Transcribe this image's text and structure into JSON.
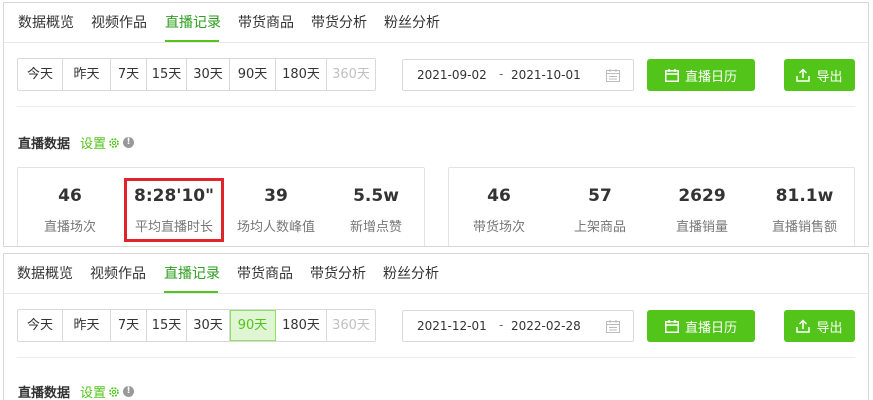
{
  "tabs": [
    "数据概览",
    "视频作品",
    "直播记录",
    "带货商品",
    "带货分析",
    "粉丝分析"
  ],
  "active_tab": "直播记录",
  "range_buttons": [
    "今天",
    "昨天",
    "7天",
    "15天",
    "30天",
    "90天",
    "180天",
    "360天"
  ],
  "panel_top": {
    "date_start": "2021-09-02",
    "date_end": "2021-10-01",
    "selected_range": ""
  },
  "panel_bottom": {
    "date_start": "2021-12-01",
    "date_end": "2022-02-28",
    "selected_range": "90天"
  },
  "date_separator": "-",
  "calendar_button_label": "直播日历",
  "export_button_label": "导出",
  "section_title": "直播数据",
  "settings_label": "设置",
  "stats_left": [
    {
      "value": "46",
      "label": "直播场次"
    },
    {
      "value": "8:28'10\"",
      "label": "平均直播时长"
    },
    {
      "value": "39",
      "label": "场均人数峰值"
    },
    {
      "value": "5.5w",
      "label": "新增点赞"
    }
  ],
  "stats_right": [
    {
      "value": "46",
      "label": "带货场次"
    },
    {
      "value": "57",
      "label": "上架商品"
    },
    {
      "value": "2629",
      "label": "直播销量"
    },
    {
      "value": "81.1w",
      "label": "直播销售额"
    }
  ],
  "colors": {
    "accent": "#52c41a",
    "active_tab_text": "#2e9e1f",
    "highlight": "#e0242b",
    "selected_bg": "#dff5d3"
  },
  "icons": {
    "calendar": "calendar-icon",
    "export": "upload-icon",
    "settings": "gear-icon",
    "info": "info-icon"
  }
}
